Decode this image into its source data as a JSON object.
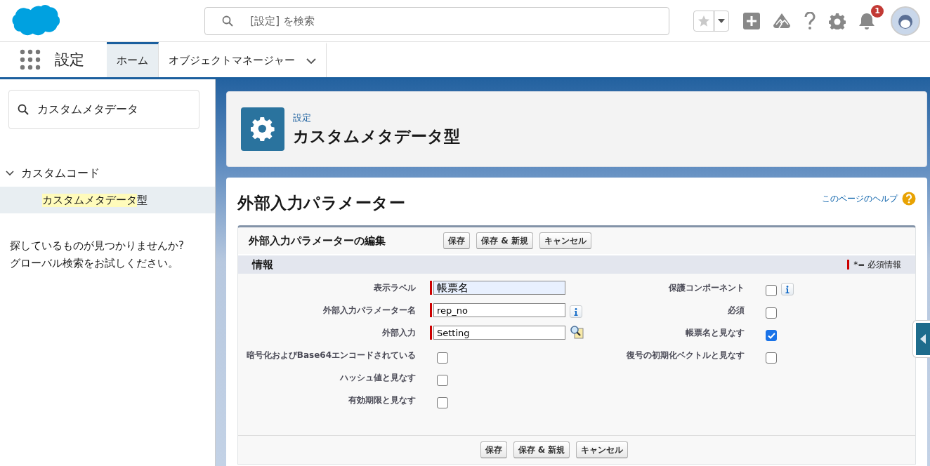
{
  "header": {
    "search": {
      "placeholder": "[設定] を検索"
    },
    "notifications": {
      "count": "1"
    }
  },
  "nav": {
    "app_name": "設定",
    "tabs": [
      {
        "label": "ホーム",
        "selected": true,
        "dropdown": false
      },
      {
        "label": "オブジェクトマネージャー",
        "selected": false,
        "dropdown": true
      }
    ]
  },
  "sidebar": {
    "search": {
      "value": "カスタムメタデータ"
    },
    "tree": [
      {
        "label": "カスタムコード",
        "expanded": true,
        "children": [
          {
            "label": "カスタムメタデータ型",
            "selected": true
          }
        ]
      }
    ],
    "not_found": "探しているものが見つかりませんか?\nグローバル検索をお試しください。"
  },
  "page_header": {
    "breadcrumb": "設定",
    "title": "カスタムメタデータ型"
  },
  "record": {
    "title": "外部入力パラメーター",
    "help_link": "このページのヘルプ",
    "edit": {
      "title": "外部入力パラメーターの編集",
      "buttons": [
        "保存",
        "保存 & 新規",
        "キャンセル"
      ],
      "section": "情報",
      "required_legend": "*= 必須情報",
      "left_fields": [
        {
          "label": "表示ラベル",
          "kind": "text",
          "value": "帳票名",
          "required": true,
          "focused": true,
          "info": false
        },
        {
          "label": "外部入力パラメーター名",
          "kind": "text",
          "value": "rep_no",
          "required": true,
          "focused": false,
          "info": true
        },
        {
          "label": "外部入力",
          "kind": "lookup",
          "value": "Setting",
          "required": true,
          "focused": false,
          "info": false
        },
        {
          "label": "暗号化およびBase64エンコードされている",
          "kind": "checkbox",
          "checked": false,
          "info": false
        },
        {
          "label": "ハッシュ値と見なす",
          "kind": "checkbox",
          "checked": false,
          "info": false
        },
        {
          "label": "有効期限と見なす",
          "kind": "checkbox",
          "checked": false,
          "info": false
        }
      ],
      "right_fields": [
        {
          "label": "保護コンポーネント",
          "kind": "checkbox",
          "checked": false,
          "info": true
        },
        {
          "label": "必須",
          "kind": "checkbox",
          "checked": false,
          "info": false
        },
        {
          "label": "帳票名と見なす",
          "kind": "checkbox",
          "checked": true,
          "info": false
        },
        {
          "label": "復号の初期化ベクトルと見なす",
          "kind": "checkbox",
          "checked": false,
          "info": false
        }
      ],
      "bottom_buttons": [
        "保存",
        "保存 & 新規",
        "キャンセル"
      ]
    }
  }
}
